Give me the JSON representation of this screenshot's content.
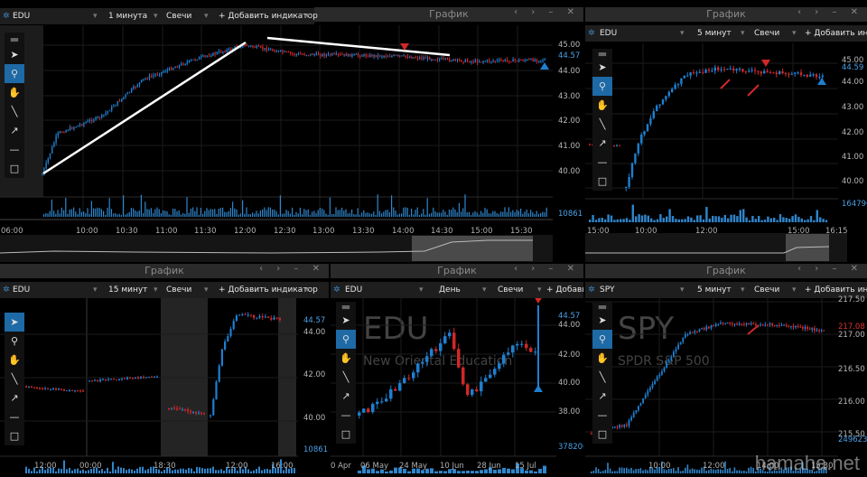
{
  "panels": {
    "p1": {
      "window_title": "",
      "toolbar": {
        "symbol": "EDU",
        "interval": "1 минута",
        "chart_type": "Свечи",
        "add_indicator": "+ Добавить индикатор"
      },
      "price_labels": [
        "45.00",
        "44.00",
        "43.00",
        "42.00",
        "41.00",
        "40.00"
      ],
      "current_price": "44.57",
      "volume_value": "10861",
      "time_labels": [
        "06:00",
        "10:00",
        "10:30",
        "11:00",
        "11:30",
        "12:00",
        "12:30",
        "13:00",
        "13:30",
        "14:00",
        "14:30",
        "15:00",
        "15:30"
      ]
    },
    "p1_right_title": "График",
    "p2": {
      "window_title": "График",
      "toolbar": {
        "symbol": "EDU",
        "interval": "5 минут",
        "chart_type": "Свечи",
        "add_indicator": "+ Добавить индик"
      },
      "price_labels": [
        "45.00",
        "44.00",
        "43.00",
        "42.00",
        "41.00",
        "40.00"
      ],
      "current_price": "44.59",
      "volume_value": "164796",
      "time_labels": [
        "15:00",
        "10:00",
        "12:00",
        "15:00",
        "16:15"
      ]
    },
    "p3": {
      "window_title": "График",
      "toolbar": {
        "symbol": "EDU",
        "interval": "15 минут",
        "chart_type": "Свечи",
        "add_indicator": "+ Добавить индикатор"
      },
      "price_labels": [
        "44.00",
        "42.00",
        "40.00"
      ],
      "current_price": "44.57",
      "volume_value": "10861",
      "time_labels": [
        "12:00",
        "00:00",
        "18:30",
        "12:00",
        "16:00"
      ]
    },
    "p4": {
      "window_title": "График",
      "toolbar": {
        "symbol": "EDU",
        "interval": "День",
        "chart_type": "Свечи",
        "add_indicator": "+ Добавить"
      },
      "watermark_symbol": "EDU",
      "watermark_name": "New Oriental Education",
      "price_labels": [
        "44.00",
        "42.00",
        "40.00",
        "38.00"
      ],
      "current_price": "44.57",
      "volume_value": "3782064",
      "time_labels": [
        "0 Apr",
        "06 May",
        "24 May",
        "10 Jun",
        "28 Jun",
        "15 Jul"
      ]
    },
    "p5": {
      "window_title": "График",
      "toolbar": {
        "symbol": "SPY",
        "interval": "5 минут",
        "chart_type": "Свечи",
        "add_indicator": "+ Добавить индик"
      },
      "watermark_symbol": "SPY",
      "watermark_name": "SPDR S&P 500",
      "price_labels": [
        "217.50",
        "217.00",
        "216.50",
        "216.00",
        "215.50"
      ],
      "current_price": "217.08",
      "volume_value": "2496234",
      "time_labels": [
        "10:00",
        "12:00",
        "14:00",
        "15:30"
      ]
    }
  },
  "footer": {
    "site": "hamaha.net"
  },
  "colors": {
    "up": "#1e7fd0",
    "down": "#d02828",
    "accent": "#3b86c4"
  }
}
